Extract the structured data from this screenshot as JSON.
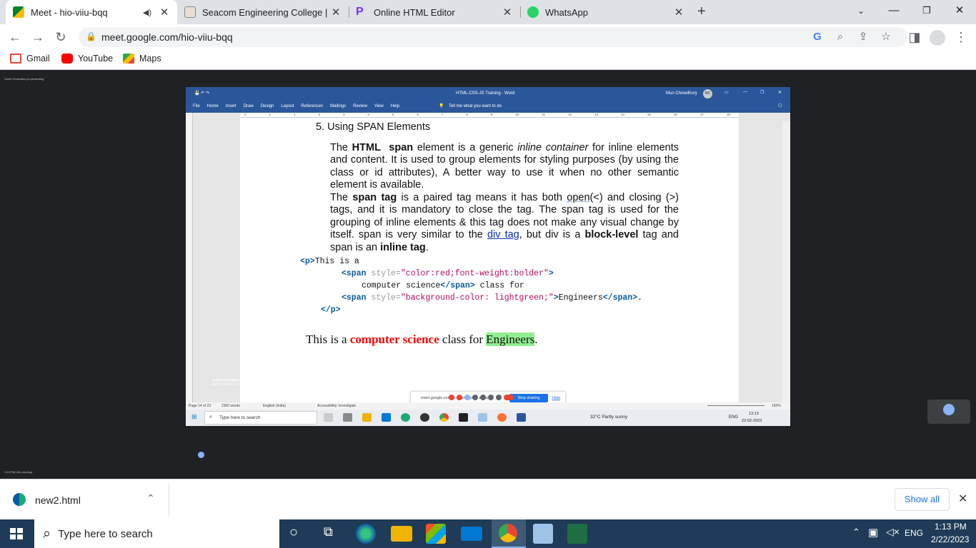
{
  "browser": {
    "tabs": [
      {
        "title": "Meet - hio-viiu-bqq",
        "active": true
      },
      {
        "title": "Seacom Engineering College | Be"
      },
      {
        "title": "Online HTML Editor"
      },
      {
        "title": "WhatsApp"
      }
    ],
    "url": "meet.google.com/hio-viiu-bqq",
    "bookmarks": [
      "Gmail",
      "YouTube",
      "Maps"
    ]
  },
  "meet": {
    "presenting_label": "Sumit Chowdhury is presenting",
    "caption_name": "Sumit Chowdhury",
    "caption_text": "Inline content, it is called as an inline, container line under here. Online Elements of Content for Styling Karts. They go. This line is. Span style, then color",
    "meeting_time": "1:13 PM | hio-viiu-bqq"
  },
  "word": {
    "window_title": "HTML-CSS-JS Training - Word",
    "user": "Mun Chowdhury",
    "user_initials": "MC",
    "ribbon_tabs": [
      "File",
      "Home",
      "Insert",
      "Draw",
      "Design",
      "Layout",
      "References",
      "Mailings",
      "Review",
      "View",
      "Help"
    ],
    "tell_me": "Tell me what you want to do",
    "ruler_numbers": [
      "2",
      "1",
      "1",
      "2",
      "3",
      "4",
      "5",
      "6",
      "7",
      "8",
      "9",
      "10",
      "11",
      "12",
      "13",
      "14",
      "15",
      "16",
      "17",
      "18"
    ],
    "status": {
      "page": "Page 14 of 23",
      "words": "2360 words",
      "language": "English (India)",
      "accessibility": "Accessibility: Investigate",
      "zoom": "160%"
    }
  },
  "document": {
    "heading": "5.  Using SPAN Elements",
    "p1_t1": "The ",
    "p1_html": "HTML",
    "p1_span": "span",
    "p1_t2": " element is a generic ",
    "p1_ic": "inline container",
    "p1_t3": " for inline elements and content. It is used to group elements for styling purposes (by using the class or id attributes), A better way to use it when no other semantic element is available.",
    "p2_t1": "The ",
    "p2_spantag": "span tag",
    "p2_t2": " is a paired tag means it has both ",
    "p2_open": "open",
    "p2_t3": "(<) and closing (>) tags, and it is mandatory to close the tag. The span tag is used for the grouping of inline elements & this tag does not make any visual change by itself. span is very similar to the ",
    "p2_div": "div tag",
    "p2_t4": ", but div is a ",
    "p2_block": "block-level",
    "p2_t5": " tag and span is an ",
    "p2_inline": "inline tag",
    "p2_t6": ".",
    "code": {
      "l1_tag": "<p>",
      "l1_text": "This is a",
      "l2_open": "<span",
      "l2_attr": " style=",
      "l2_val": "\"color:red;font-weight:bolder\"",
      "l2_close": ">",
      "l3_text": "computer science",
      "l3_tag": "</span>",
      "l3_text2": " class for",
      "l4_open": "<span",
      "l4_attr": " style=",
      "l4_val": "\"background-color: lightgreen;\"",
      "l4_close": ">",
      "l4_text": "Engineers",
      "l4_end": "</span>",
      "l4_dot": ".",
      "l5_tag": "</p>"
    },
    "rendered_t1": "This is a ",
    "rendered_red": "computer science",
    "rendered_t2": " class for ",
    "rendered_green": "Engineers",
    "rendered_t3": "."
  },
  "share_bar": {
    "text": "meet.google.com is sharing your screen.",
    "stop": "Stop sharing",
    "hide": "Hide"
  },
  "inner_taskbar": {
    "search": "Type here to search",
    "weather": "32°C  Partly sunny",
    "lang": "ENG",
    "time": "13:13",
    "date": "22-02-2023"
  },
  "downloads": {
    "file": "new2.html",
    "show_all": "Show all"
  },
  "taskbar": {
    "search": "Type here to search",
    "lang": "ENG",
    "time": "1:13 PM",
    "date": "2/22/2023"
  },
  "colors": {
    "word_blue": "#2b579a",
    "taskbar": "#1f3b57",
    "meet_bg": "#202124",
    "red_text": "#ff0000",
    "lightgreen": "#90ee90"
  }
}
